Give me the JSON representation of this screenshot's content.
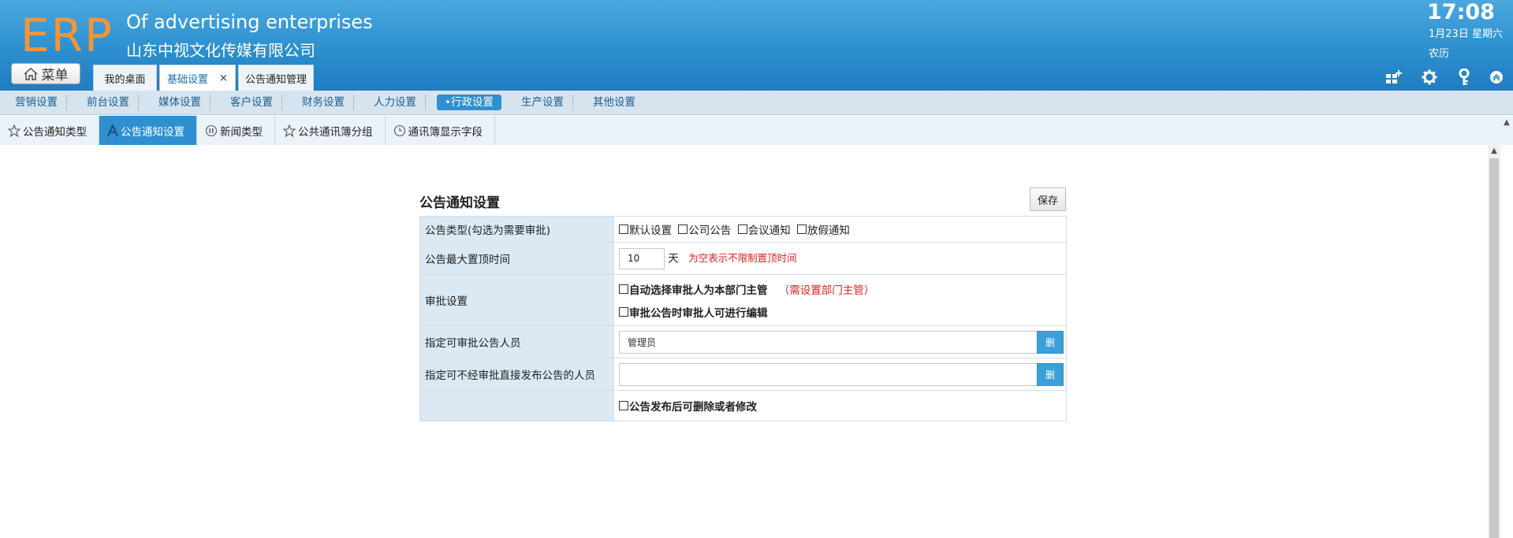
{
  "header": {
    "logo": "ERP",
    "company_en": "Of advertising enterprises",
    "company_cn": "山东中视文化传媒有限公司",
    "time": "17:08",
    "date": "1月23日 星期六",
    "lunar": "农历",
    "menu_label": "菜单",
    "tabs": [
      {
        "label": "我的桌面"
      },
      {
        "label": "基础设置",
        "close": "×"
      },
      {
        "label": "公告通知管理"
      }
    ],
    "icons": [
      "grid-add-icon",
      "gear-icon",
      "key-icon",
      "collapse-up-icon"
    ]
  },
  "catnav": {
    "items": [
      "营销设置",
      "前台设置",
      "媒体设置",
      "客户设置",
      "财务设置",
      "人力设置",
      "•行政设置",
      "生产设置",
      "其他设置"
    ],
    "active_index": 6
  },
  "subtabs": [
    {
      "label": "公告通知类型",
      "icon": "star-icon"
    },
    {
      "label": "公告通知设置",
      "icon": "font-a-icon"
    },
    {
      "label": "新闻类型",
      "icon": "pause-circle-icon"
    },
    {
      "label": "公共通讯簿分组",
      "icon": "star-icon"
    },
    {
      "label": "通讯簿显示字段",
      "icon": "clock-icon"
    }
  ],
  "panel": {
    "title": "公告通知设置",
    "save_label": "保存",
    "rows": {
      "notice_type": {
        "label": "公告类型(勾选为需要审批)",
        "options": [
          "默认设置",
          "公司公告",
          "会议通知",
          "放假通知"
        ]
      },
      "max_top": {
        "label": "公告最大置顶时间",
        "value": "10",
        "unit": "天",
        "hint": "为空表示不限制置顶时间"
      },
      "approval": {
        "label": "审批设置",
        "option1": "自动选择审批人为本部门主管",
        "option1_hint": "（需设置部门主管）",
        "option2": "审批公告时审批人可进行编辑"
      },
      "approvers": {
        "label": "指定可审批公告人员",
        "value": "管理员",
        "button": "删"
      },
      "direct_publish": {
        "label": "指定可不经审批直接发布公告的人员",
        "value": "",
        "button": "删"
      },
      "editable": {
        "label": "",
        "option": "公告发布后可删除或者修改"
      }
    }
  },
  "colors": {
    "header_blue": "#2d8fcf",
    "logo_orange": "#f2953a",
    "active_blue": "#2f8fd0",
    "hint_red": "#e02020",
    "label_bg": "#dbe9f4"
  }
}
